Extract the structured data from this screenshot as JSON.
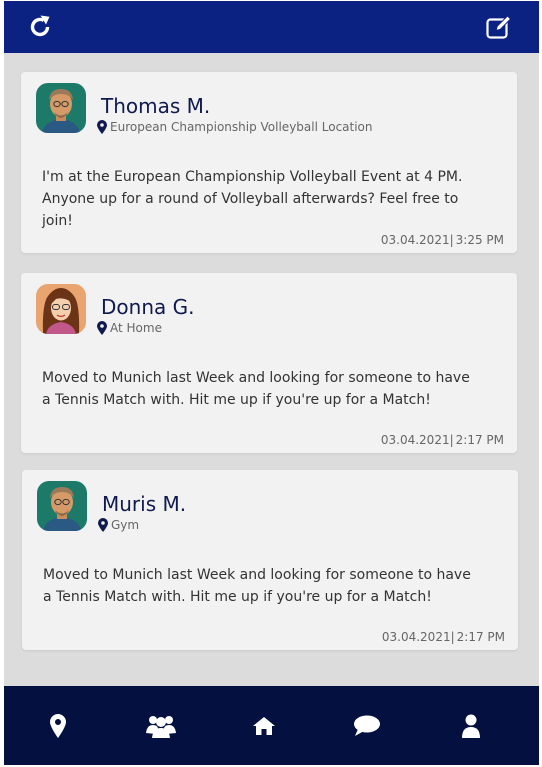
{
  "header": {
    "refresh_icon": "refresh-icon",
    "compose_icon": "edit-icon",
    "bar_color": "#0b2282"
  },
  "posts": [
    {
      "name": "Thomas M.",
      "location": "European Championship Volleyball Location",
      "text": "I'm at the European Championship Volleyball Event at 4 PM. Anyone up for a round of Volleyball afterwards? Feel free to join!",
      "date": "03.04.2021",
      "time": "3:25 PM"
    },
    {
      "name": "Donna G.",
      "location": "At Home",
      "text": "Moved to Munich last Week and looking for someone to have a Tennis Match with. Hit me up if you're up for a Match!",
      "date": "03.04.2021",
      "time": "2:17 PM"
    },
    {
      "name": "Muris M.",
      "location": "Gym",
      "text": "Moved to Munich last Week and looking for someone to have a Tennis Match with. Hit me up if you're up for a Match!",
      "date": "03.04.2021",
      "time": "2:17 PM"
    }
  ],
  "bottom_nav": {
    "items": [
      "map-pin-icon",
      "group-icon",
      "home-icon",
      "chat-icon",
      "profile-icon"
    ],
    "bar_color": "#031040"
  }
}
